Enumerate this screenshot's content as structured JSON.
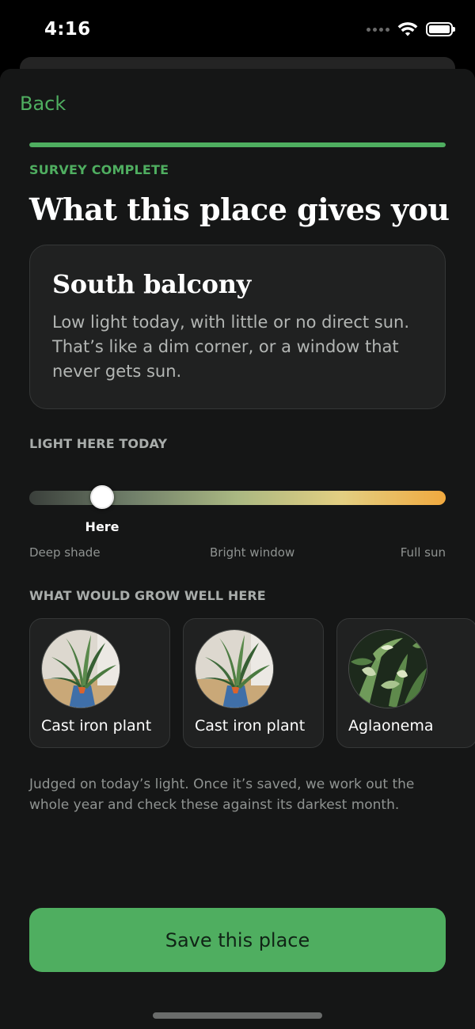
{
  "status_bar": {
    "time": "4:16",
    "icons": [
      "cellular-dots-icon",
      "wifi-icon",
      "battery-icon"
    ]
  },
  "header": {
    "back_label": "Back",
    "progress": 1.0,
    "eyebrow": "SURVEY COMPLETE",
    "title": "What this place gives you"
  },
  "summary": {
    "place_name": "South balcony",
    "description": "Low light today, with little or no direct sun. That’s like a dim corner, or a window that never gets sun."
  },
  "light": {
    "section_label": "LIGHT HERE TODAY",
    "marker_label": "Here",
    "level": 0.175,
    "scale_labels": [
      "Deep shade",
      "Bright window",
      "Full sun"
    ],
    "gradient_colors": [
      "#3a3f3b",
      "#71806a",
      "#aab882",
      "#e3cf82",
      "#f0a93f"
    ]
  },
  "plants": {
    "section_label": "WHAT WOULD GROW WELL HERE",
    "items": [
      {
        "name": "Cast iron plant"
      },
      {
        "name": "Cast iron plant"
      },
      {
        "name": "Aglaonema"
      }
    ]
  },
  "footnote": "Judged on today’s light. Once it’s saved, we work out the whole year and check these against its darkest month.",
  "actions": {
    "save_label": "Save this place"
  },
  "colors": {
    "accent": "#4fae60",
    "background": "#151616",
    "card": "#202121"
  }
}
